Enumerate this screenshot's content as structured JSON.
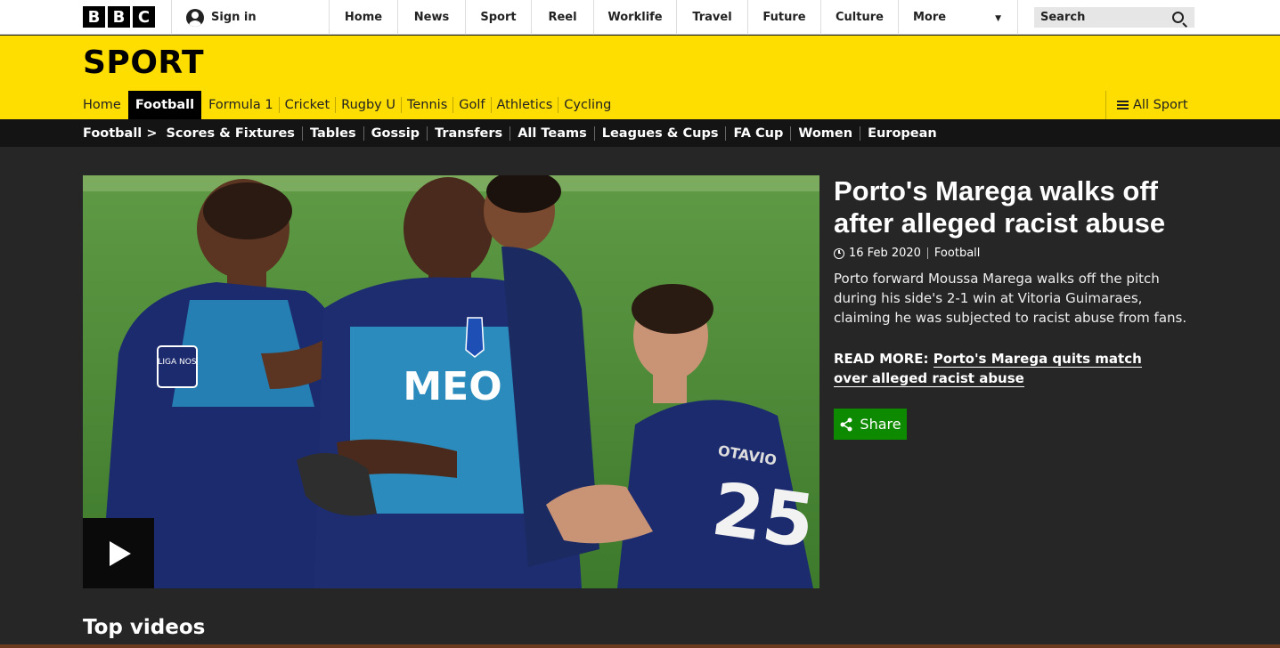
{
  "global_nav": {
    "logo_letters": [
      "B",
      "B",
      "C"
    ],
    "sign_in": "Sign in",
    "items": [
      "Home",
      "News",
      "Sport",
      "Reel",
      "Worklife",
      "Travel",
      "Future",
      "Culture"
    ],
    "more": "More",
    "search_label": "Search"
  },
  "banner": {
    "title": "SPORT"
  },
  "sport_nav": {
    "items": [
      "Home",
      "Football",
      "Formula 1",
      "Cricket",
      "Rugby U",
      "Tennis",
      "Golf",
      "Athletics",
      "Cycling"
    ],
    "active": "Football",
    "all_sport": "All Sport"
  },
  "football_nav": {
    "home": "Football >",
    "items": [
      "Scores & Fixtures",
      "Tables",
      "Gossip",
      "Transfers",
      "All Teams",
      "Leagues & Cups",
      "FA Cup",
      "Women",
      "European"
    ]
  },
  "article": {
    "headline": "Porto's Marega walks off after alleged racist abuse",
    "date": "16 Feb 2020",
    "section": "Football",
    "summary": "Porto forward Moussa Marega walks off the pitch during his side's 2-1 win at Vitoria Guimaraes, claiming he was subjected to racist abuse from fans.",
    "read_more_prefix": "READ MORE:",
    "read_more_link": "Porto's Marega quits match over alleged racist abuse",
    "share": "Share"
  },
  "media": {
    "shirt_sponsor": "MEO",
    "sleeve_badge": "LIGA NOS",
    "back_name": "OTAVIO",
    "back_number": "25"
  },
  "section_heading": "Top videos",
  "colors": {
    "brand_yellow": "#fedd00",
    "share_green": "#0e8a00",
    "page_bg": "#262626"
  }
}
